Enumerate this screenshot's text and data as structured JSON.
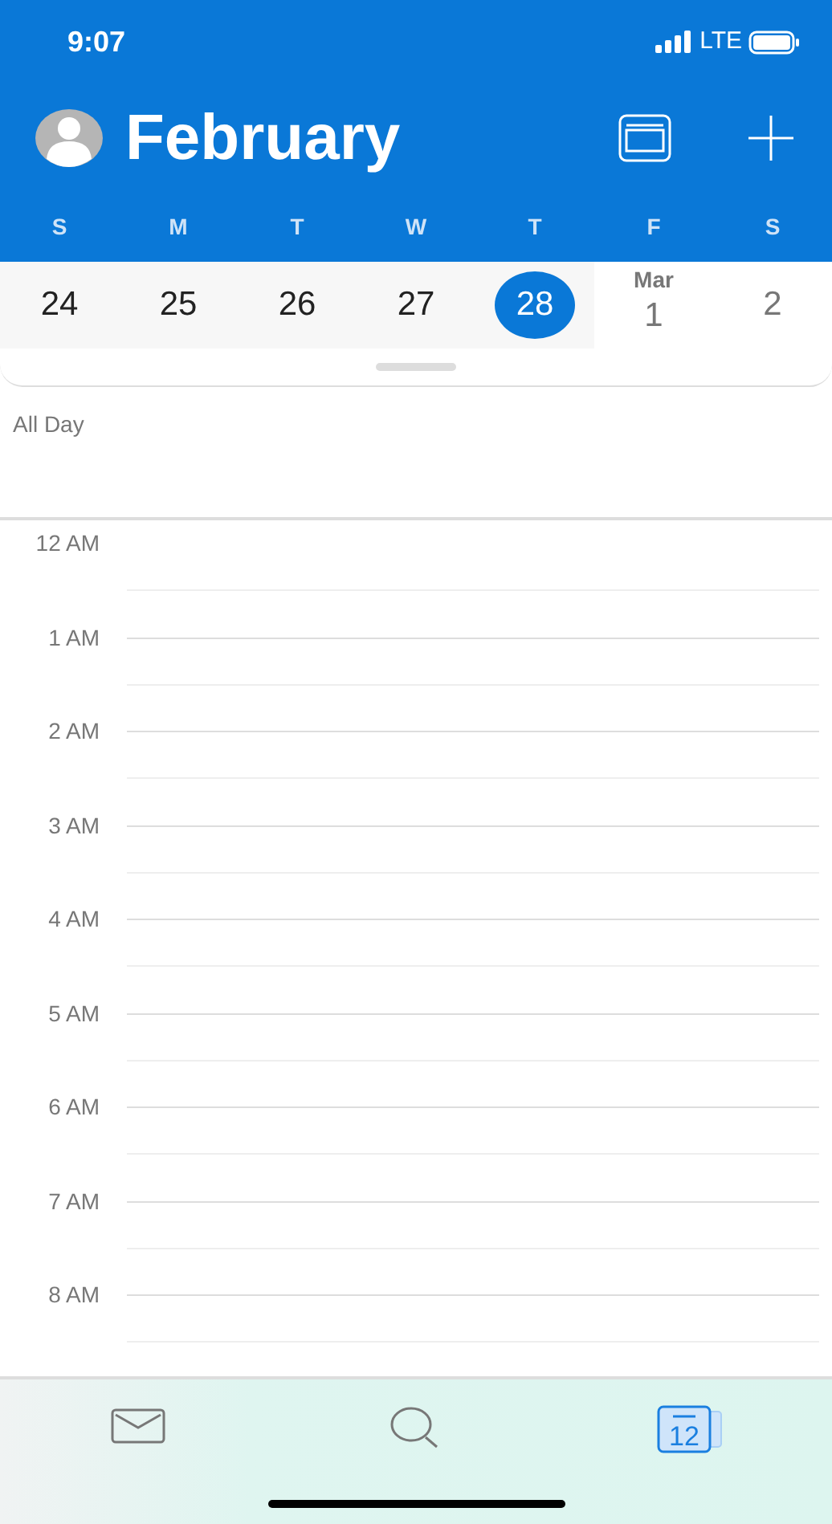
{
  "status_bar": {
    "time": "9:07",
    "network": "LTE"
  },
  "header": {
    "title": "February"
  },
  "weekdays": [
    "S",
    "M",
    "T",
    "W",
    "T",
    "F",
    "S"
  ],
  "dates": [
    {
      "day": "24",
      "shaded": true,
      "selected": false
    },
    {
      "day": "25",
      "shaded": true,
      "selected": false
    },
    {
      "day": "26",
      "shaded": true,
      "selected": false
    },
    {
      "day": "27",
      "shaded": true,
      "selected": false
    },
    {
      "day": "28",
      "shaded": true,
      "selected": true
    },
    {
      "month": "Mar",
      "day": "1",
      "shaded": false,
      "selected": false
    },
    {
      "day": "2",
      "shaded": false,
      "selected": false
    }
  ],
  "all_day_label": "All Day",
  "hours": [
    "12 AM",
    "1 AM",
    "2 AM",
    "3 AM",
    "4 AM",
    "5 AM",
    "6 AM",
    "7 AM",
    "8 AM"
  ],
  "tab_bar": [
    {
      "kind": "mail",
      "selected": false
    },
    {
      "kind": "search",
      "selected": false
    },
    {
      "kind": "calendar",
      "selected": true,
      "day": "12"
    }
  ]
}
